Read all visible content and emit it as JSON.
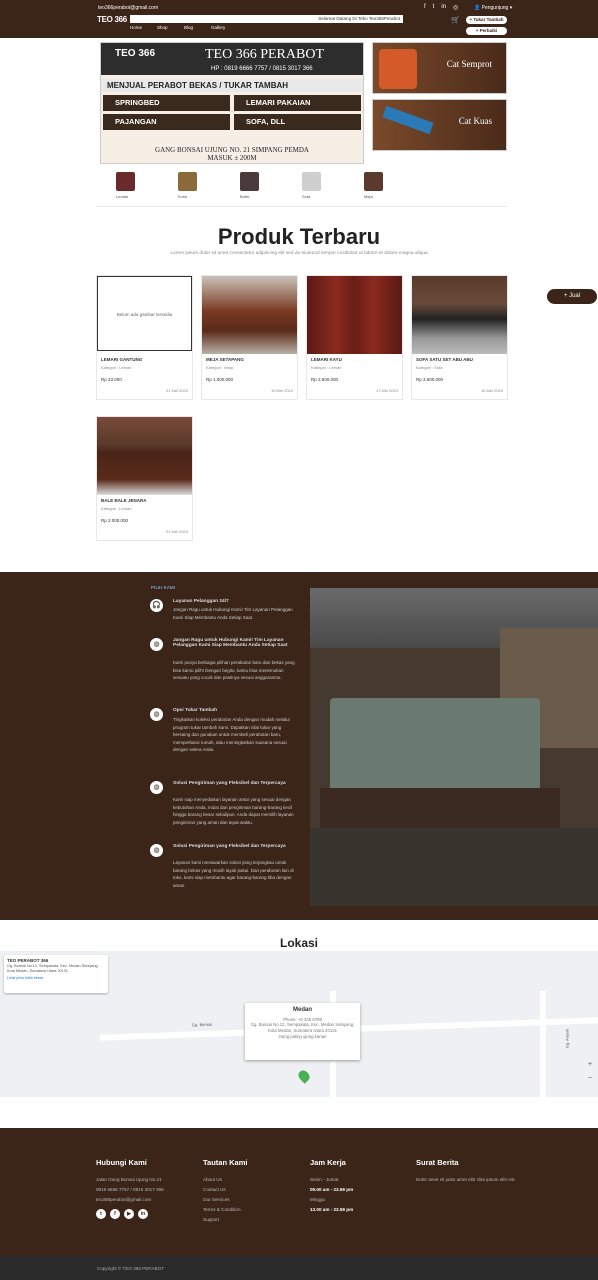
{
  "topbar": {
    "email": "teo366perabot@gmail.com",
    "account": "Pengunjung",
    "logo": "TEO 366",
    "marquee": "Selamat Datang Di Teko Teo366Perabot",
    "nav": [
      "Home",
      "Shop",
      "Blog",
      "Gallery"
    ],
    "btn_tambah": "+ Tukar Tambah",
    "btn_perbaiki": "+ Perbaiki"
  },
  "banner": {
    "logo": "TEO 366",
    "title": "TEO 366 PERABOT",
    "hp": "HP : 0819 6666 7757 / 0815 3017 366",
    "sub": "MENJUAL PERABOT BEKAS / TUKAR TAMBAH",
    "items": [
      "SPRINGBED",
      "LEMARI PAKAIAN",
      "PAJANGAN",
      "SOFA, DLL"
    ],
    "addr1": "GANG BONSAI UJUNG NO. 21 SIMPANG PEMDA",
    "addr2": "MASUK ± 200M"
  },
  "side_ads": [
    {
      "label": "Cat Semprot"
    },
    {
      "label": "Cat Kuas"
    }
  ],
  "categories": [
    "Lemari",
    "Kursi",
    "Bufet",
    "Sofa",
    "Meja"
  ],
  "section": {
    "title": "Produk Terbaru",
    "subtitle": "Lorem ipsum dolor sit amet consectetur adipiscing elit sed do eiusmod tempor incididunt ut labore et dolore magna aliqua"
  },
  "products": [
    {
      "name": "LEMARI GANTUNG",
      "category": "Kategori : Lemari",
      "price": "Rp 23.000",
      "date": "21 Mei 2024",
      "placeholder": "Belum ada gambar tersedia"
    },
    {
      "name": "MEJA SETAPANG",
      "category": "Kategori : Meja",
      "price": "Rp 1.000.000",
      "date": "19 Mei 2024"
    },
    {
      "name": "LEMARI KAYU",
      "category": "Kategori : Lemari",
      "price": "Rp 2.500.000",
      "date": "17 Mei 2024"
    },
    {
      "name": "SOFA SATU SET ABU ABU",
      "category": "Kategori : Sofa",
      "price": "Rp 3.500.000",
      "date": "16 Mei 2024"
    },
    {
      "name": "BALE BALE JENARA",
      "category": "Kategori : Lemari",
      "price": "Rp 2.000.000",
      "date": "21 Mei 2024"
    }
  ],
  "jual_button": "+ Jual",
  "why": {
    "tag": "PILIH KAMI",
    "items": [
      {
        "title": "Layanan Pelanggan 24/7",
        "text": "Jangan Ragu untuk Hubungi Kami! Tim Layanan Pelanggan Kami Siap Membantu Anda Setiap Saat."
      },
      {
        "title": "Jangan Ragu untuk Hubungi Kami! Tim Layanan Pelanggan Kami Siap Membantu Anda Setiap Saat",
        "text": "Kami punya berbagai pilihan perabotan baru dan bekas yang bisa kamu pilih! Dengan begitu, kamu bisa menemukan sesuatu yang cocok dan pastinya sesuai anggaranmu."
      },
      {
        "title": "Opsi Tukar Tambah",
        "text": "Tingkatkan koleksi perabotan Anda dengan mudah melalui program tukar tambah kami. Dapatkan nilai tukar yang bersaing dan gunakan untuk membeli perabotan baru, memperbarui rumah, atau meningkatkan suasana sesuai dengan selera Anda."
      },
      {
        "title": "Solusi Pengiriman yang Fleksibel dan Terpercaya",
        "text": "Kami siap menyediakan layanan antar yang sesuai dengan kebutuhan Anda, mulai dari pengiriman barang-barang kecil hingga barang besar sekalipun. Anda dapat memilih layanan pengiriman yang aman dan tepat waktu."
      },
      {
        "title": "Solusi Pengiriman yang Fleksibel dan Terpercaya",
        "text": "Layanan kami menawarkan solusi yang terjangkau untuk barang bekas yang masih layak pakai. Dan perabotan lain di toko, kami siap membantu agar barang-barang tiba dengan aman."
      }
    ]
  },
  "location": {
    "title": "Lokasi",
    "place": "TEO PERABOT 366",
    "addr": "Gg. Bonsai No.12, Sempakata, Kec. Medan Selayang, Kota Medan, Sumatera Utara 20131",
    "map_link": "Lihat peta lebih besar",
    "popup_title": "Medan",
    "popup_phone": "Phone: +0 345 6789",
    "popup_text": "Gg. Bonsai No.12, Sempakata, Kec. Medan Selayang, Kota Medan, Sumatera Utara 20131",
    "popup_text2": "Gang paling ujung kanan",
    "map_labels": [
      "Gg. Bonsai",
      "Gg. Anyelir"
    ]
  },
  "footer": {
    "contact_title": "Hubungi Kami",
    "contact": [
      "Jalan Gang Bonsai Ujung No.21",
      "0819 6666 7757 / 0815 3017 366",
      "teo366perabot@gmail.com"
    ],
    "links_title": "Tautan Kami",
    "links": [
      "About Us",
      "Contact Us",
      "Our Services",
      "Terms & Condition",
      "Support"
    ],
    "hours_title": "Jam Kerja",
    "hours": [
      "Senin - Jumat",
      "09.00 am - 23.59 pm",
      "Minggu",
      "13.00 am - 23.59 pm"
    ],
    "news_title": "Surat Berita",
    "news_text": "Dolor amet sit justo amet elitr clita ipsum elitr est.",
    "copyright": "Copyright © TEO 366 PERABOT"
  }
}
